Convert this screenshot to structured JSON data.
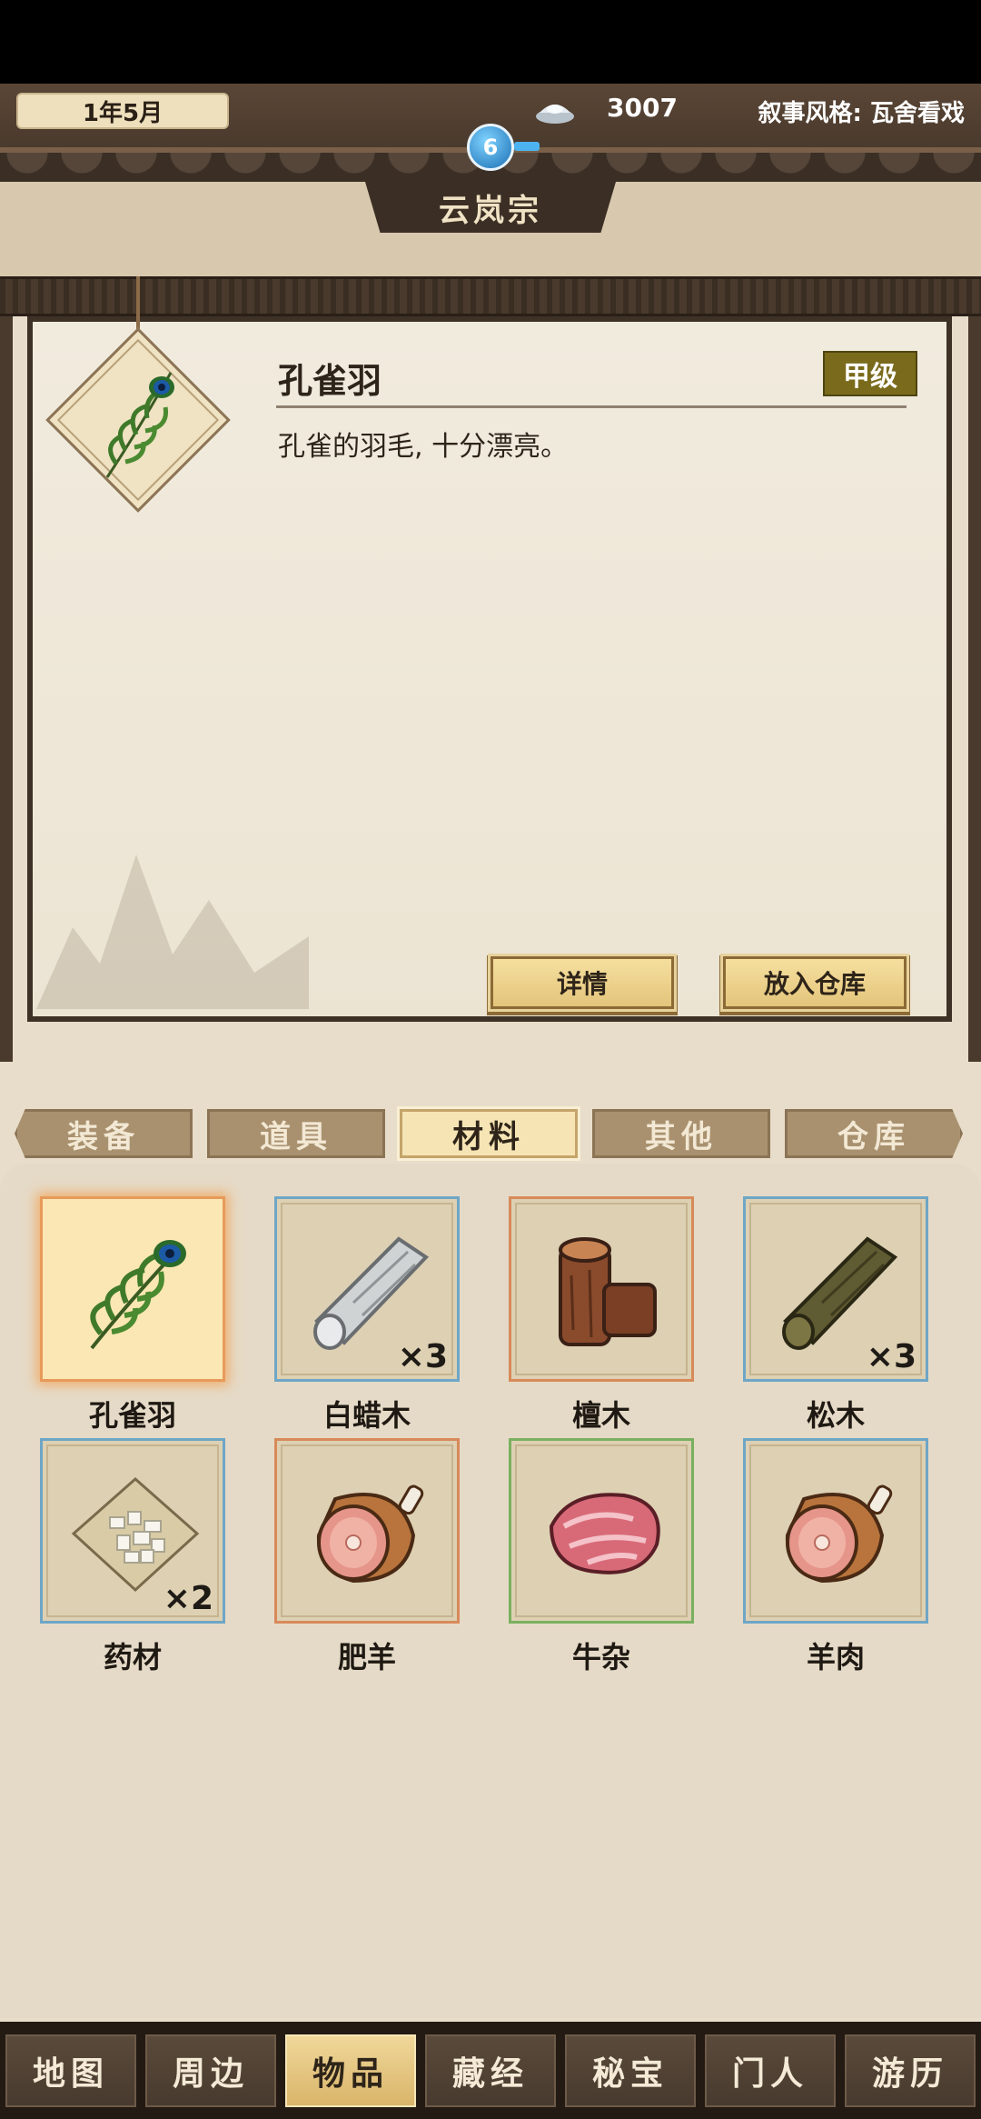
{
  "header": {
    "date": "1年5月",
    "silver": "3007",
    "style_label": "叙事风格: 瓦舍看戏",
    "level": "6",
    "sect_name": "云岚宗"
  },
  "detail": {
    "name": "孔雀羽",
    "grade": "甲级",
    "description": "孔雀的羽毛, 十分漂亮。",
    "btn_detail": "详情",
    "btn_store": "放入仓库"
  },
  "tabs": [
    "装备",
    "道具",
    "材料",
    "其他",
    "仓库"
  ],
  "active_tab": "材料",
  "items": [
    {
      "name": "孔雀羽",
      "qty": "",
      "icon": "peacock-feather-icon"
    },
    {
      "name": "白蜡木",
      "qty": "×3",
      "icon": "white-wood-icon"
    },
    {
      "name": "檀木",
      "qty": "",
      "icon": "sandalwood-icon"
    },
    {
      "name": "松木",
      "qty": "×3",
      "icon": "pine-wood-icon"
    },
    {
      "name": "药材",
      "qty": "×2",
      "icon": "herb-icon"
    },
    {
      "name": "肥羊",
      "qty": "",
      "icon": "ham-icon"
    },
    {
      "name": "牛杂",
      "qty": "",
      "icon": "raw-meat-icon"
    },
    {
      "name": "羊肉",
      "qty": "",
      "icon": "ham-icon"
    }
  ],
  "nav": [
    "地图",
    "周边",
    "物品",
    "藏经",
    "秘宝",
    "门人",
    "游历"
  ],
  "active_nav": "物品",
  "colors": {
    "grade_badge": "#7a6a1c",
    "active_tab": "#f6e4b4",
    "active_nav": "#d9b56a"
  }
}
